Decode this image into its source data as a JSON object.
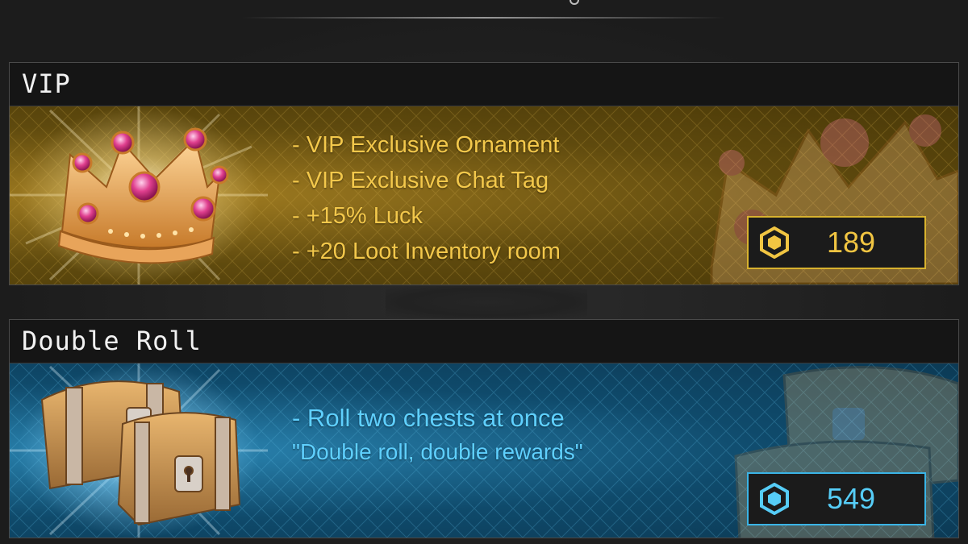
{
  "products": [
    {
      "id": "vip",
      "title": "VIP",
      "benefits": [
        "- VIP Exclusive Ornament",
        "- VIP Exclusive Chat Tag",
        "- +15% Luck",
        "- +20 Loot Inventory room"
      ],
      "price": "189",
      "currency_icon": "robux-coin-icon",
      "accent_color": "#f3c84b"
    },
    {
      "id": "double-roll",
      "title": "Double Roll",
      "benefits": [
        "- Roll two chests at once",
        "\"Double roll, double rewards\""
      ],
      "price": "549",
      "currency_icon": "robux-coin-icon",
      "accent_color": "#5fd0ff"
    }
  ]
}
